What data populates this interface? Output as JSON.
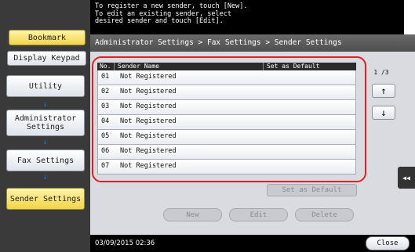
{
  "sidebar": {
    "bookmark_label": "Bookmark",
    "display_keypad_label": "Display Keypad",
    "steps": [
      {
        "label": "Utility"
      },
      {
        "label": "Administrator Settings"
      },
      {
        "label": "Fax Settings"
      },
      {
        "label": "Sender Settings"
      }
    ],
    "arrow_glyph": "↓"
  },
  "header": {
    "message_line1": "To register a new sender, touch [New].",
    "message_line2": "To edit an existing sender, select",
    "message_line3": "desired sender and touch [Edit]."
  },
  "breadcrumb": "Administrator Settings > Fax Settings > Sender Settings",
  "table": {
    "headers": {
      "no": "No.",
      "name": "Sender Name",
      "default": "Set as Default"
    },
    "rows": [
      {
        "no": "01",
        "name": "Not Registered",
        "default": ""
      },
      {
        "no": "02",
        "name": "Not Registered",
        "default": ""
      },
      {
        "no": "03",
        "name": "Not Registered",
        "default": ""
      },
      {
        "no": "04",
        "name": "Not Registered",
        "default": ""
      },
      {
        "no": "05",
        "name": "Not Registered",
        "default": ""
      },
      {
        "no": "06",
        "name": "Not Registered",
        "default": ""
      },
      {
        "no": "07",
        "name": "Not Registered",
        "default": ""
      }
    ]
  },
  "pager": {
    "page": "1 /3",
    "up_glyph": "↑",
    "down_glyph": "↓"
  },
  "actions": {
    "set_default_label": "Set as Default",
    "new_label": "New",
    "edit_label": "Edit",
    "delete_label": "Delete"
  },
  "side_tab_glyph": "◀◀",
  "footer": {
    "datetime": "03/09/2015   02:36",
    "close_label": "Close"
  },
  "colors": {
    "highlight_frame": "#e02020",
    "step_arrow": "#2e6fd6",
    "selected_step": "#f2d44a"
  }
}
